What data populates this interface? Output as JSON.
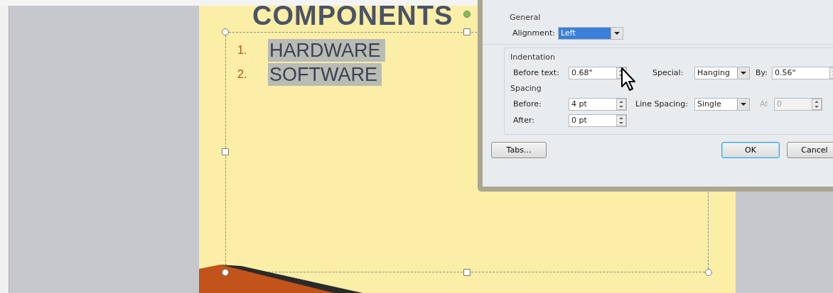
{
  "slide": {
    "title": "COMPONENTS",
    "list": [
      {
        "number": "1.",
        "text": "HARDWARE",
        "selected": true
      },
      {
        "number": "2.",
        "text": "SOFTWARE",
        "selected": true
      }
    ]
  },
  "dialog": {
    "general": {
      "heading": "General",
      "alignment": {
        "label": "Alignment:",
        "value": "Left",
        "selected": true
      }
    },
    "indentation": {
      "heading": "Indentation",
      "before_text": {
        "label": "Before text:",
        "value": "0.68\""
      },
      "special": {
        "label": "Special:",
        "value": "Hanging"
      },
      "by": {
        "label": "By:",
        "value": "0.56\""
      }
    },
    "spacing": {
      "heading": "Spacing",
      "before": {
        "label": "Before:",
        "value": "4 pt"
      },
      "line_spacing": {
        "label": "Line Spacing:",
        "value": "Single"
      },
      "at": {
        "label": "At",
        "value": "0",
        "disabled": true
      },
      "after": {
        "label": "After:",
        "value": "0 pt"
      }
    },
    "buttons": [
      {
        "label": "Tabs...",
        "kind": "left",
        "default": false
      },
      {
        "label": "OK",
        "kind": "right",
        "default": true
      },
      {
        "label": "Cancel",
        "kind": "right",
        "default": false
      }
    ]
  }
}
